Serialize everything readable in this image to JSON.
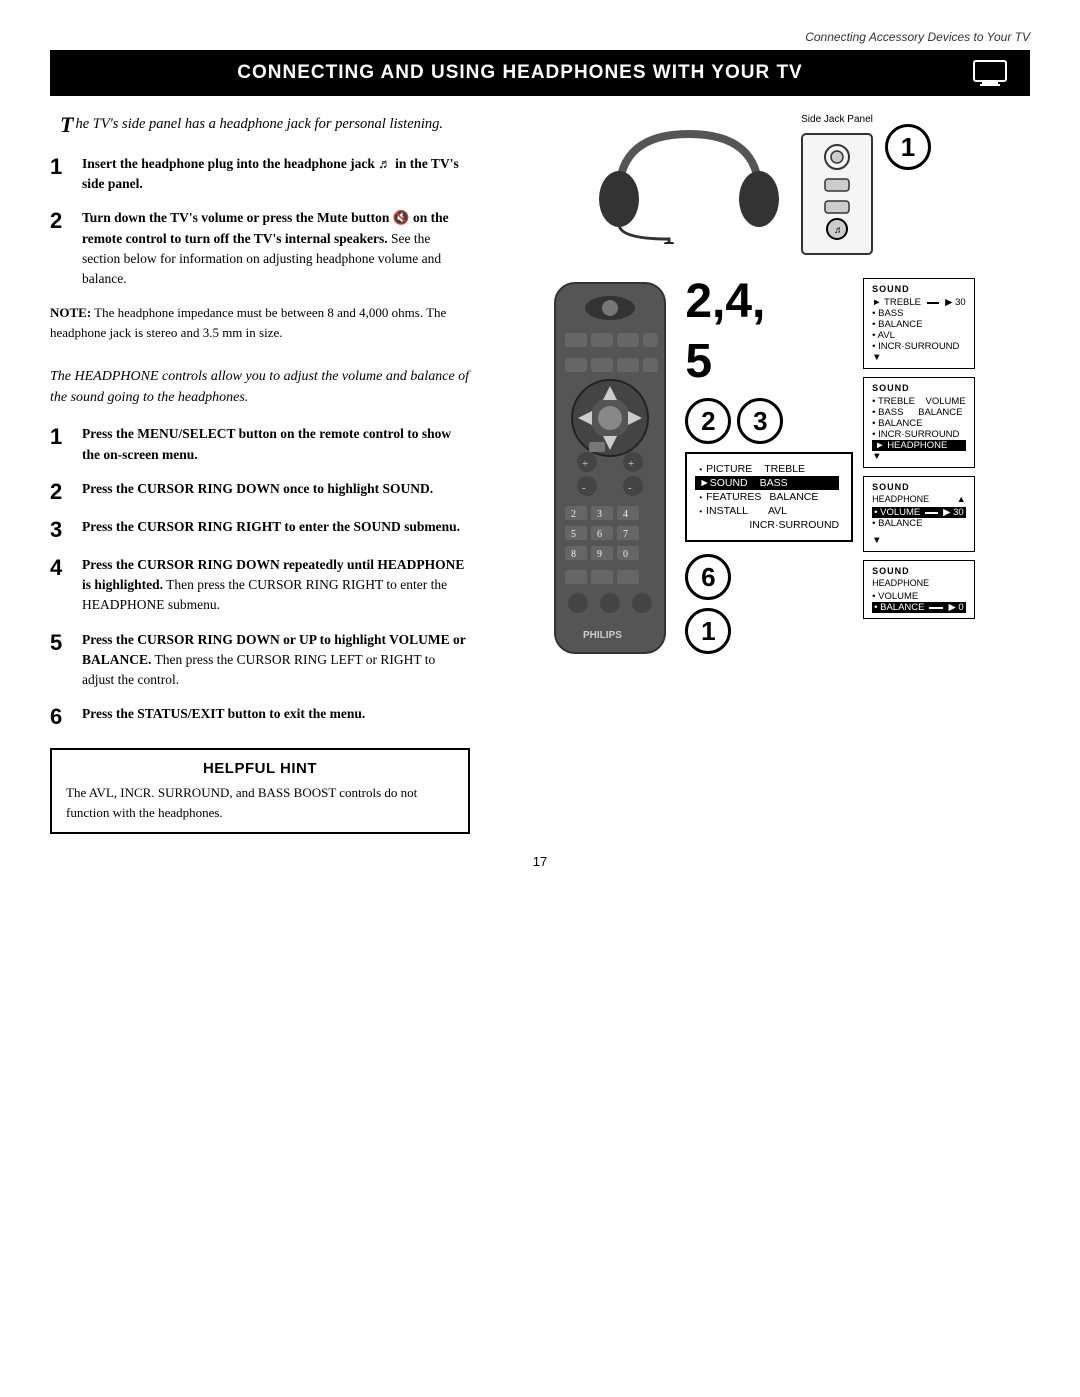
{
  "header": {
    "section_title": "Connecting Accessory Devices to Your TV"
  },
  "title_bar": {
    "text": "Connecting and Using Headphones with Your TV"
  },
  "intro": {
    "drop_cap": "T",
    "text": "he TV's side panel has a headphone jack for personal listening."
  },
  "steps_part1": [
    {
      "num": "1",
      "bold": "Insert the headphone plug into the headphone jack",
      "bold_suffix": " in the TV's side panel.",
      "rest": ""
    },
    {
      "num": "2",
      "bold": "Turn down the TV's volume or press the Mute button",
      "bold_suffix": " on the remote control to turn off the TV's internal speakers.",
      "rest": " See the section below for information on adjusting headphone volume and balance."
    }
  ],
  "note": {
    "label": "NOTE:",
    "text": " The headphone impedance must be between 8 and 4,000 ohms. The headphone jack is stereo and 3.5 mm in size."
  },
  "section2_intro": {
    "drop_cap": "T",
    "text": "he HEADPHONE controls allow you to adjust the volume and balance of the sound going to the headphones."
  },
  "steps_part2": [
    {
      "num": "1",
      "text": "Press the MENU/SELECT button on the remote control to show the on-screen menu."
    },
    {
      "num": "2",
      "text": "Press the CURSOR RING DOWN once to highlight SOUND."
    },
    {
      "num": "3",
      "text": "Press the CURSOR RING RIGHT to enter the SOUND submenu."
    },
    {
      "num": "4",
      "bold": "Press the CURSOR RING DOWN repeatedly until HEADPHONE is highlighted.",
      "rest": " Then press the CURSOR RING RIGHT to enter the HEADPHONE submenu."
    },
    {
      "num": "5",
      "bold": "Press the CURSOR RING DOWN or UP to highlight VOLUME or BALANCE.",
      "rest": " Then press the CURSOR RING LEFT or RIGHT to adjust the control."
    },
    {
      "num": "6",
      "bold": "Press the STATUS/EXIT button to exit the menu."
    }
  ],
  "hint": {
    "title": "Helpful Hint",
    "text": "The AVL, INCR. SURROUND, and BASS BOOST controls do not function with the headphones."
  },
  "diagrams": {
    "side_jack_label": "Side Jack Panel",
    "menu1": {
      "items": [
        {
          "label": "• PICTURE",
          "right": "TREBLE",
          "selected": false
        },
        {
          "label": "▶SOUND",
          "right": "BASS",
          "selected": true
        },
        {
          "label": "• FEATURES",
          "right": "BALANCE",
          "selected": false
        },
        {
          "label": "• INSTALL",
          "right": "AVL",
          "selected": false
        },
        {
          "label": "",
          "right": "INCR·SURROUND",
          "selected": false
        }
      ]
    },
    "menu2": {
      "title": "SOUND",
      "items": [
        {
          "label": "• TREBLE",
          "bar": true,
          "val": "30",
          "selected": false
        },
        {
          "label": "• BASS",
          "selected": false
        },
        {
          "label": "• BALANCE",
          "selected": false
        },
        {
          "label": "• AVL",
          "selected": false
        },
        {
          "label": "• INCR·SURROUND",
          "selected": false
        },
        {
          "label": "▼",
          "selected": false
        }
      ]
    },
    "menu3": {
      "title": "SOUND",
      "items": [
        {
          "label": "• TREBLE",
          "right": "VOLUME",
          "selected": false
        },
        {
          "label": "• BASS",
          "right": "BALANCE",
          "selected": false
        },
        {
          "label": "• BALANCE",
          "selected": false
        },
        {
          "label": "• INCR·SURROUND",
          "selected": false
        },
        {
          "label": "▶HEADPHONE",
          "selected": true
        },
        {
          "label": "▼",
          "selected": false
        }
      ]
    },
    "menu4": {
      "title": "SOUND",
      "subtitle": "HEADPHONE",
      "items": [
        {
          "label": "• VOLUME",
          "bar": true,
          "val": "30",
          "selected": true
        },
        {
          "label": "• BALANCE",
          "selected": false
        }
      ],
      "arrow_down": true
    },
    "menu5": {
      "title": "SOUND",
      "subtitle": "HEADPHONE",
      "items": [
        {
          "label": "• VOLUME",
          "selected": false
        },
        {
          "label": "• BALANCE",
          "bar": true,
          "val": "0",
          "selected": true
        }
      ]
    }
  },
  "page_number": "17",
  "philips_brand": "PHILIPS"
}
